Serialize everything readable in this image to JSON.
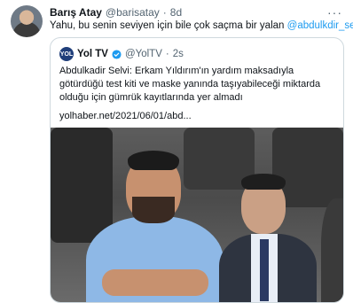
{
  "tweet": {
    "author_name": "Barış Atay",
    "author_handle": "@barisatay",
    "separator": "·",
    "time": "8d",
    "more_glyph": "···",
    "text_main": "Yahu, bu senin seviyen için bile çok saçma bir yalan",
    "text_mention": "@abdulkdir_selvi"
  },
  "quote": {
    "avatar_text": "YOL",
    "name": "Yol TV",
    "handle": "@YolTV",
    "separator": "·",
    "time": "2s",
    "text": "Abdulkadir Selvi: Erkam Yıldırım'ın yardım maksadıyla götürdüğü test kiti ve maske yanında taşıyabileceği miktarda olduğu için gümrük kayıtlarında yer almadı",
    "link": "yolhaber.net/2021/06/01/abd..."
  },
  "colors": {
    "accent": "#1d9bf0",
    "text": "#0f1419",
    "muted": "#536471",
    "border": "#cfd9de"
  }
}
